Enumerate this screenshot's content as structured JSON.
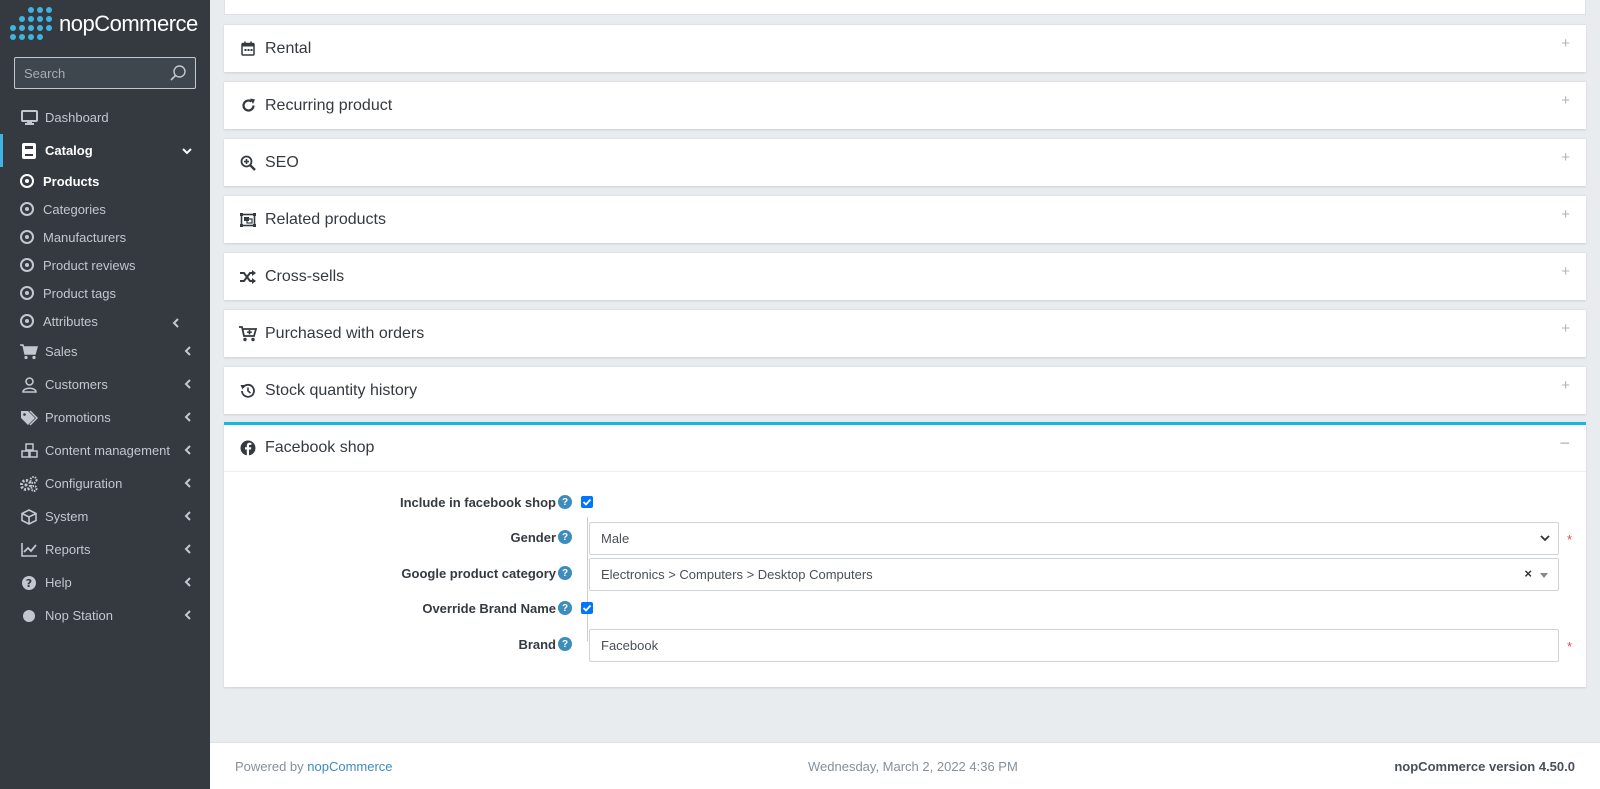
{
  "brand": {
    "name": "nopCommerce"
  },
  "search": {
    "placeholder": "Search"
  },
  "sidebar": {
    "items": [
      {
        "label": "Dashboard",
        "icon": "monitor-icon"
      },
      {
        "label": "Catalog",
        "icon": "book-icon",
        "active": true
      },
      {
        "label": "Sales",
        "icon": "cart-icon"
      },
      {
        "label": "Customers",
        "icon": "user-icon"
      },
      {
        "label": "Promotions",
        "icon": "tags-icon"
      },
      {
        "label": "Content management",
        "icon": "cubes-icon"
      },
      {
        "label": "Configuration",
        "icon": "gears-icon"
      },
      {
        "label": "System",
        "icon": "cube-icon"
      },
      {
        "label": "Reports",
        "icon": "chart-icon"
      },
      {
        "label": "Help",
        "icon": "question-circle-icon"
      },
      {
        "label": "Nop Station",
        "icon": "circle-icon"
      }
    ],
    "catalog_sub": [
      {
        "label": "Products"
      },
      {
        "label": "Categories"
      },
      {
        "label": "Manufacturers"
      },
      {
        "label": "Product reviews"
      },
      {
        "label": "Product tags"
      },
      {
        "label": "Attributes"
      }
    ]
  },
  "cards": [
    {
      "title": "Rental",
      "icon": "calendar-icon"
    },
    {
      "title": "Recurring product",
      "icon": "redo-icon"
    },
    {
      "title": "SEO",
      "icon": "search-plus-icon"
    },
    {
      "title": "Related products",
      "icon": "object-group-icon"
    },
    {
      "title": "Cross-sells",
      "icon": "random-icon"
    },
    {
      "title": "Purchased with orders",
      "icon": "cart-plus-icon"
    },
    {
      "title": "Stock quantity history",
      "icon": "history-icon"
    }
  ],
  "facebook": {
    "title": "Facebook shop",
    "include_label": "Include in facebook shop",
    "include_checked": true,
    "gender_label": "Gender",
    "gender_value": "Male",
    "category_label": "Google product category",
    "category_value": "Electronics > Computers > Desktop Computers",
    "override_label": "Override Brand Name",
    "override_checked": true,
    "brand_label": "Brand",
    "brand_value": "Facebook",
    "clear_symbol": "×",
    "required_mark": "*"
  },
  "footer": {
    "powered_prefix": "Powered by ",
    "powered_link": "nopCommerce",
    "datetime": "Wednesday, March 2, 2022 4:36 PM",
    "version": "nopCommerce version 4.50.0"
  },
  "colors": {
    "sidebar_bg": "#343a40",
    "accent": "#17b8e0",
    "help_blue": "#3c8dbc",
    "required_red": "#e74c3c"
  }
}
